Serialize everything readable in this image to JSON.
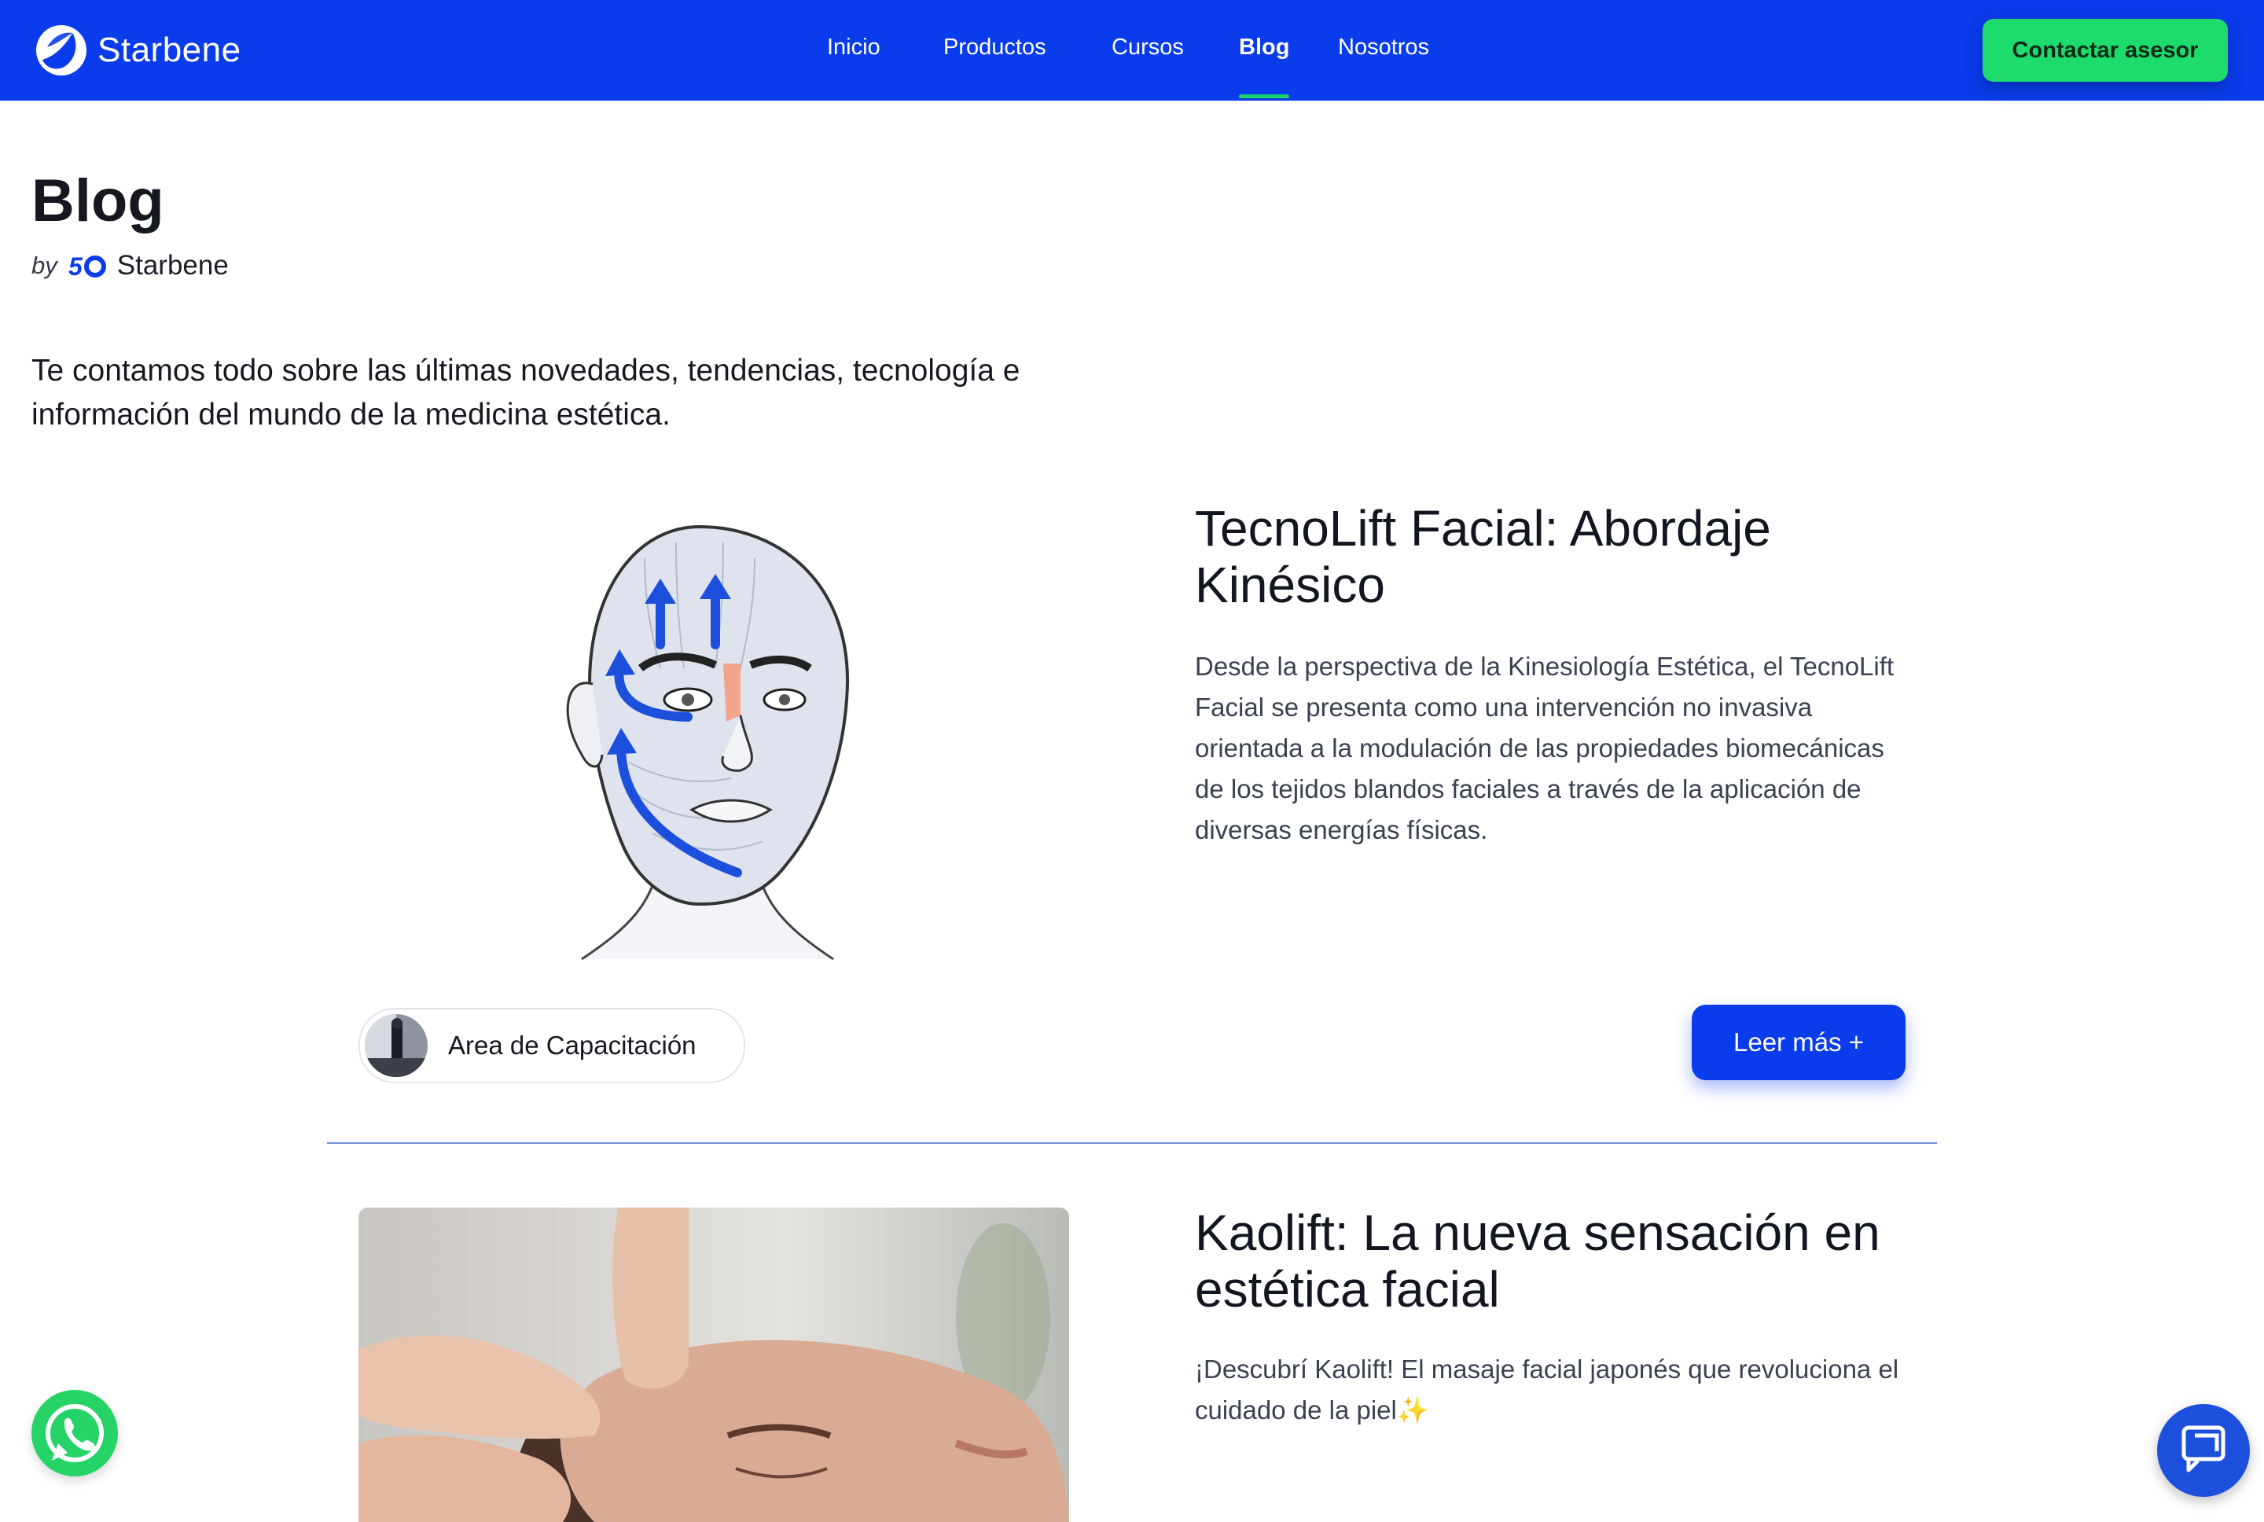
{
  "brand": {
    "name": "Starbene"
  },
  "nav": {
    "items": [
      {
        "label": "Inicio"
      },
      {
        "label": "Productos"
      },
      {
        "label": "Cursos"
      },
      {
        "label": "Blog",
        "active": true
      },
      {
        "label": "Nosotros"
      }
    ],
    "cta_label": "Contactar asesor"
  },
  "header": {
    "title": "Blog",
    "by": "by",
    "by_brand": "Starbene",
    "intro": "Te contamos todo sobre las últimas novedades, tendencias, tecnología e información del mundo de la medicina estética."
  },
  "posts": [
    {
      "title": "TecnoLift Facial: Abordaje Kinésico",
      "excerpt": "Desde la perspectiva de la Kinesiología Estética, el TecnoLift Facial se presenta como una intervención no invasiva orientada a la modulación de las propiedades biomecánicas de los tejidos blandos faciales a través de la aplicación de diversas energías físicas.",
      "category": "Area de Capacitación",
      "read_more": "Leer más +"
    },
    {
      "title": "Kaolift: La nueva sensación en estética facial",
      "excerpt": "¡Descubrí Kaolift! El masaje facial japonés que revoluciona el cuidado de la piel✨"
    }
  ],
  "floating": {
    "whatsapp_icon": "whatsapp-icon",
    "chat_icon": "chat-icon"
  },
  "colors": {
    "primary_blue": "#0a3cec",
    "accent_green": "#1edb6d",
    "divider": "#6f8fd9"
  }
}
